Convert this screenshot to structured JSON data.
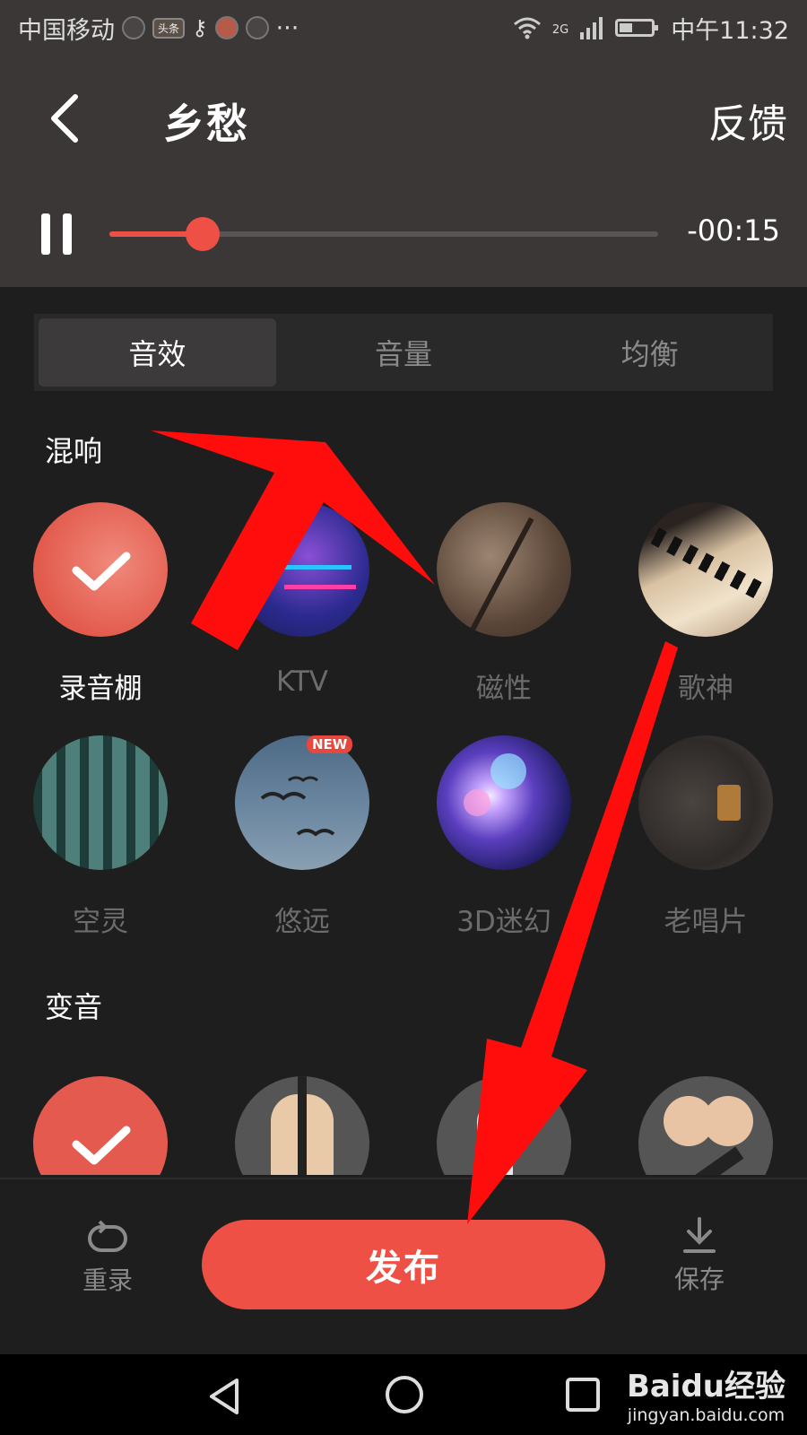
{
  "status_bar": {
    "carrier": "中国移动",
    "app_tag": "头条",
    "network": "2G",
    "time": "中午11:32"
  },
  "header": {
    "title": "乡愁",
    "feedback_label": "反馈"
  },
  "player": {
    "time_remaining": "-00:15",
    "progress": 0.17
  },
  "tabs": [
    {
      "label": "音效"
    },
    {
      "label": "音量"
    },
    {
      "label": "均衡"
    }
  ],
  "reverb": {
    "title": "混响",
    "items": [
      {
        "label": "录音棚",
        "selected": true
      },
      {
        "label": "KTV"
      },
      {
        "label": "磁性"
      },
      {
        "label": "歌神"
      },
      {
        "label": "空灵"
      },
      {
        "label": "悠远",
        "badge": "NEW"
      },
      {
        "label": "3D迷幻"
      },
      {
        "label": "老唱片"
      }
    ]
  },
  "voice_change": {
    "title": "变音"
  },
  "actions": {
    "rerecord_label": "重录",
    "publish_label": "发布",
    "save_label": "保存"
  },
  "watermark": {
    "brand": "Baidu经验",
    "url": "jingyan.baidu.com"
  },
  "colors": {
    "accent": "#ef5045",
    "header_bg": "#3b3737",
    "panel_bg": "#1e1e1e"
  }
}
